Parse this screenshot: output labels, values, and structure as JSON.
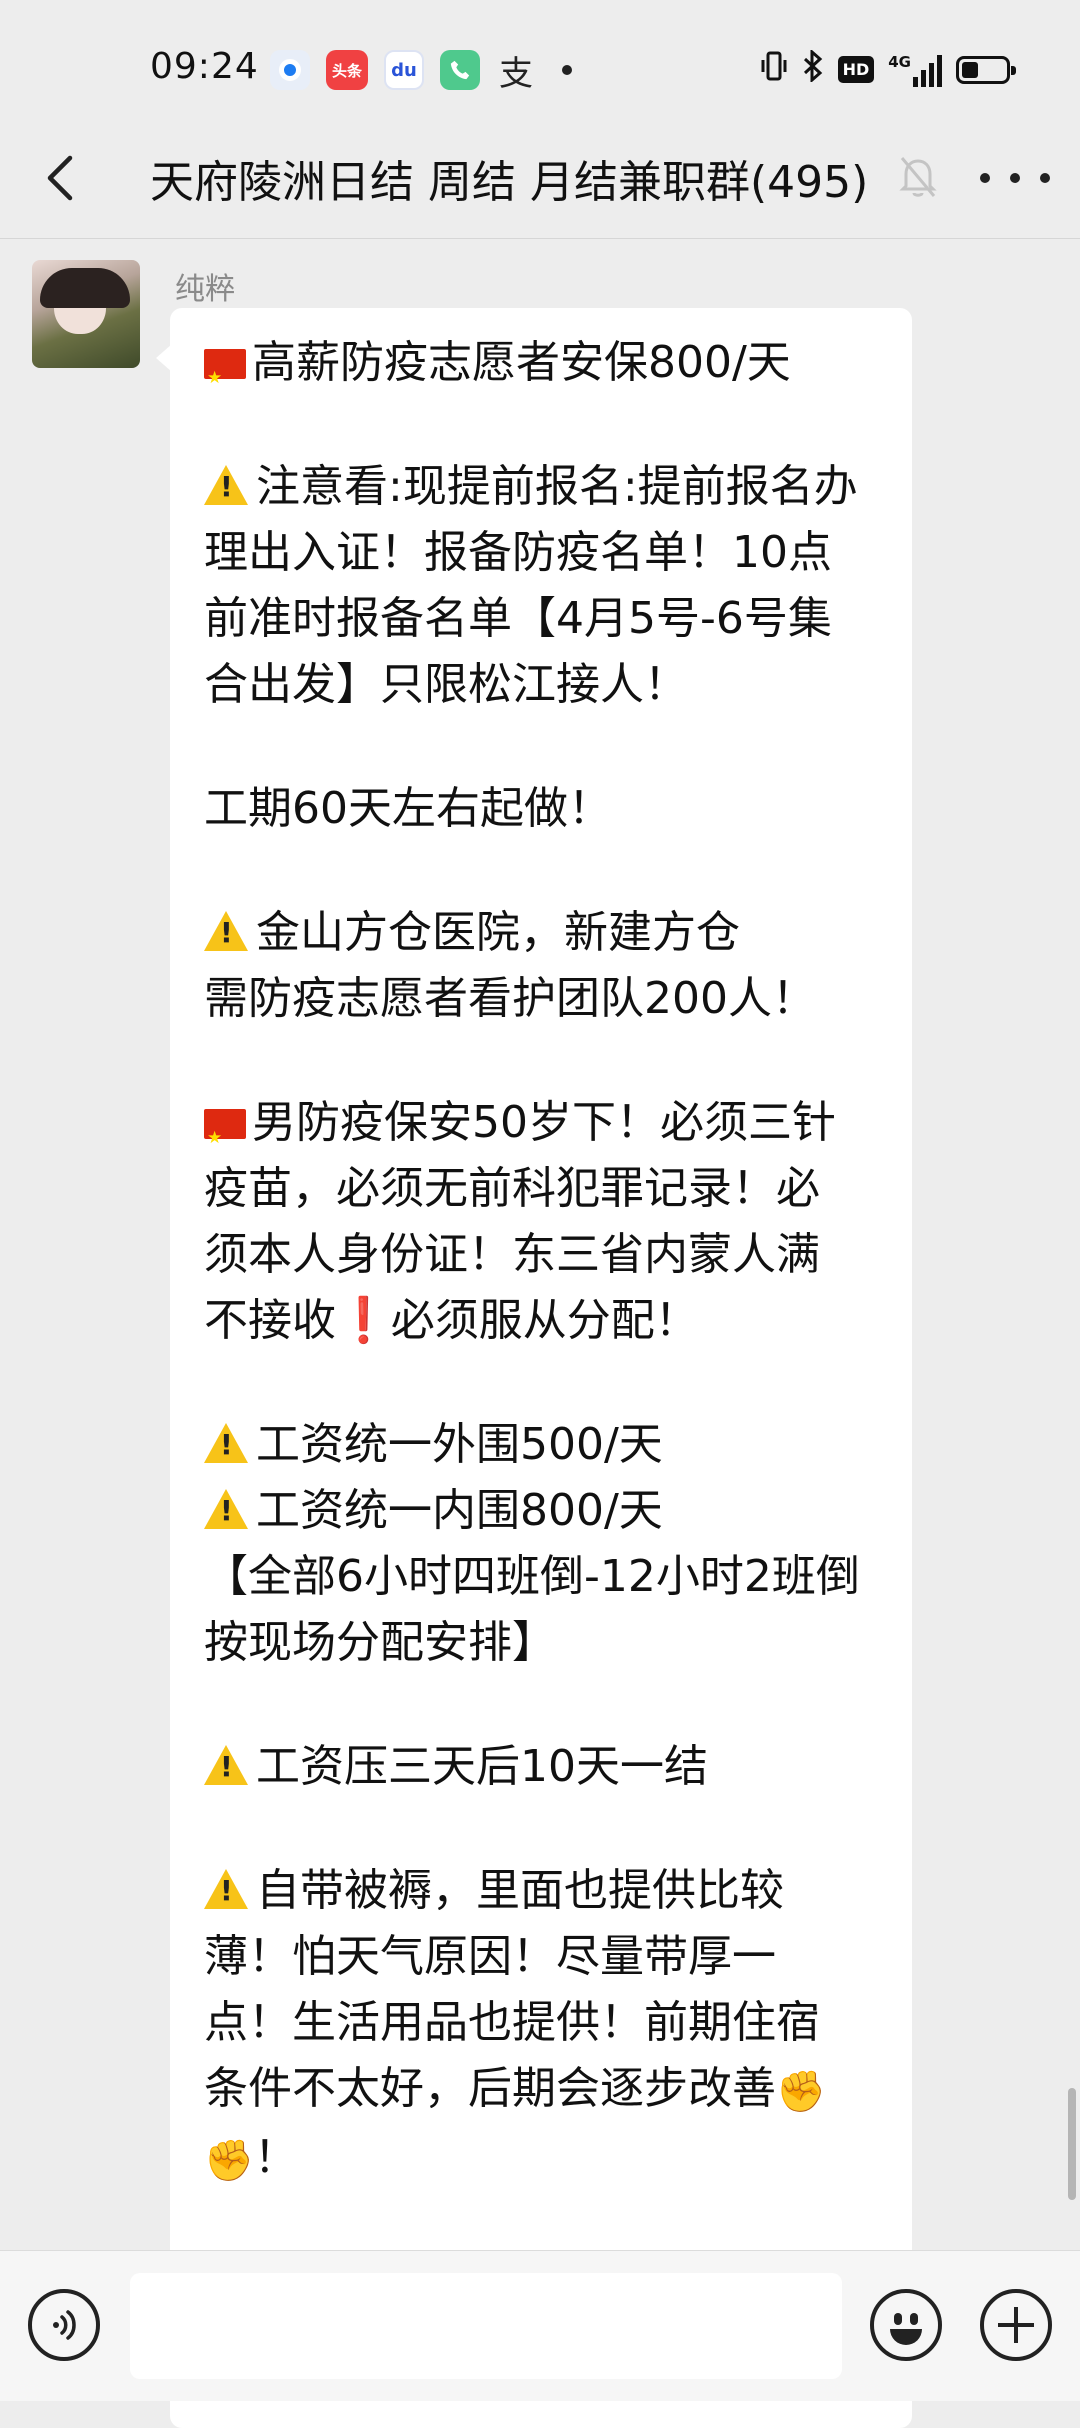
{
  "status_bar": {
    "time": "09:24",
    "notification_icons": [
      "browser-icon",
      "toutiao-icon",
      "baidu-icon",
      "phone-icon",
      "alipay-icon"
    ],
    "toutiao_label": "头条",
    "baidu_label": "du",
    "alipay_label": "支",
    "hd_label": "HD",
    "network_label": "4G"
  },
  "header": {
    "title": "天府陵洲日结 周结 月结兼职群(495)"
  },
  "message": {
    "sender": "纯粹",
    "lines": [
      "高薪防疫志愿者安保800/天",
      "",
      "注意看:现提前报名:提前报名办",
      "理出入证！报备防疫名单！10点",
      "前准时报备名单【4月5号-6号集",
      "合出发】只限松江接人！",
      "",
      "工期60天左右起做！",
      "",
      "金山方仓医院，新建方仓",
      "需防疫志愿者看护团队200人！",
      "",
      "男防疫保安50岁下！必须三针",
      "疫苗，必须无前科犯罪记录！必",
      "须本人身份证！东三省内蒙人满",
      "不接收",
      "必须服从分配！",
      "",
      "工资统一外围500/天",
      "工资统一内围800/天",
      "【全部6小时四班倒-12小时2班倒",
      "按现场分配安排】",
      "",
      "工资压三天后10天一结",
      "",
      "自带被褥，里面也提供比较",
      "薄！怕天气原因！尽量带厚一",
      "点！生活用品也提供！前期住宿",
      "条件不太好，后期会逐步改善",
      "！"
    ],
    "exclaim_glyph": "❗",
    "fist_glyph": "✊"
  },
  "input_bar": {
    "placeholder": ""
  },
  "colors": {
    "background": "#ededed",
    "bubble": "#ffffff",
    "warning": "#f7c318",
    "flag_red": "#de2910"
  }
}
